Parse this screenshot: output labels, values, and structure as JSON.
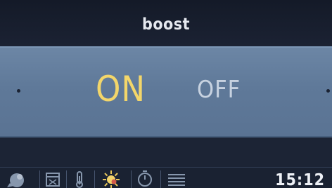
{
  "screen": {
    "title": "boost",
    "options": {
      "on_label": "ON",
      "off_label": "OFF",
      "selected": "ON"
    }
  },
  "status_bar": {
    "icons": [
      "bird-icon",
      "calendar-icon",
      "thermometer-icon",
      "sun-icon",
      "timer-icon",
      "list-icon"
    ],
    "time": "15:12"
  },
  "colors": {
    "selected_option": "#f3d66a",
    "unselected_option": "#c7d2e0",
    "band": "#5f7999",
    "background": "#1c2436"
  }
}
